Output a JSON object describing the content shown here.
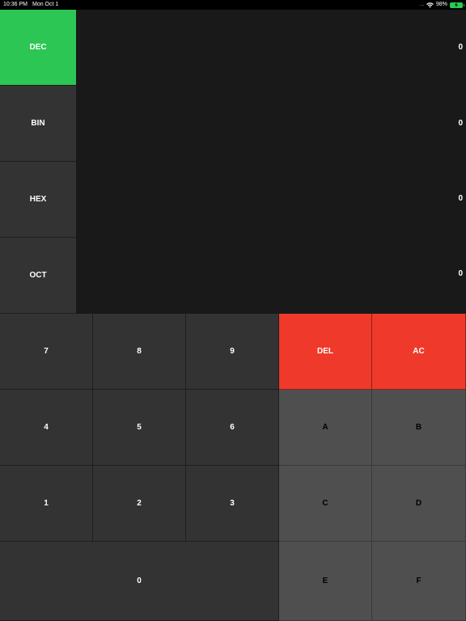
{
  "status": {
    "time": "10:36 PM",
    "date": "Mon Oct 1",
    "signal": ".....",
    "battery_percent": "98%",
    "icons": [
      "wifi-icon",
      "battery-icon"
    ],
    "battery_color": "#2bc94f"
  },
  "modes": [
    {
      "label": "DEC",
      "value": "0",
      "active": true
    },
    {
      "label": "BIN",
      "value": "0",
      "active": false
    },
    {
      "label": "HEX",
      "value": "0",
      "active": false
    },
    {
      "label": "OCT",
      "value": "0",
      "active": false
    }
  ],
  "keys": {
    "k7": "7",
    "k8": "8",
    "k9": "9",
    "del": "DEL",
    "ac": "AC",
    "k4": "4",
    "k5": "5",
    "k6": "6",
    "a": "A",
    "b": "B",
    "k1": "1",
    "k2": "2",
    "k3": "3",
    "c": "C",
    "d": "D",
    "k0": "0",
    "e": "E",
    "f": "F"
  },
  "colors": {
    "active_mode": "#2bc653",
    "delete_keys": "#ef3a2b",
    "hex_keys": "#4f4f4f",
    "digit_keys": "#333333",
    "display_bg": "#191919"
  }
}
